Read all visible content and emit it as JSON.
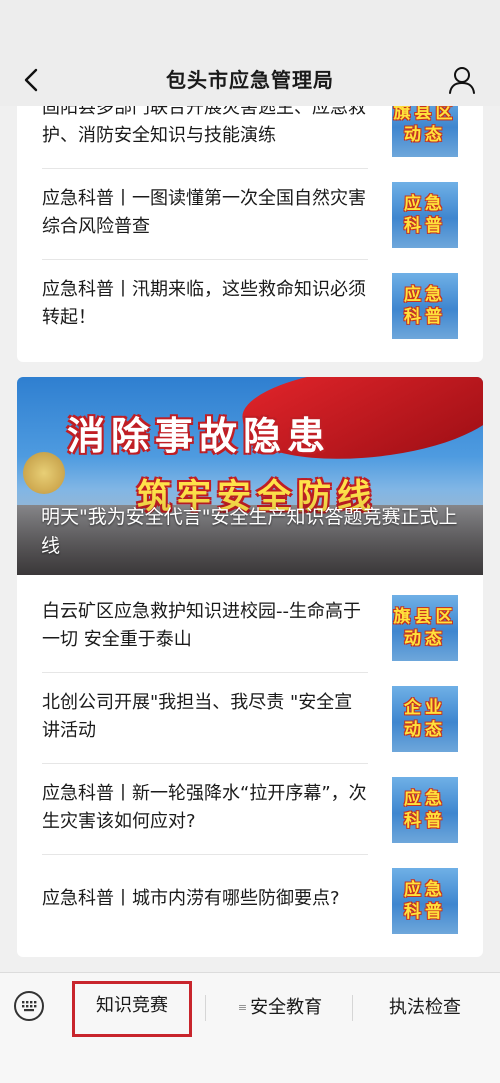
{
  "header": {
    "title": "包头市应急管理局"
  },
  "card1": {
    "items": [
      {
        "title": "固阳县多部门联合开展灾害逃生、应急救护、消防安全知识与技能演练",
        "thumb": [
          "旗县区",
          "动态"
        ]
      },
      {
        "title": "应急科普丨一图读懂第一次全国自然灾害综合风险普查",
        "thumb": [
          "应急",
          "科普"
        ]
      },
      {
        "title": "应急科普丨汛期来临，这些救命知识必须转起！",
        "thumb": [
          "应急",
          "科普"
        ]
      }
    ]
  },
  "banner": {
    "slogan_top": "消除事故隐患",
    "slogan_bottom": "筑牢安全防线",
    "caption": "明天\"我为安全代言\"安全生产知识答题竞赛正式上线"
  },
  "card2": {
    "items": [
      {
        "title": "白云矿区应急救护知识进校园--生命高于一切 安全重于泰山",
        "thumb": [
          "旗县区",
          "动态"
        ]
      },
      {
        "title": "北创公司开展\"我担当、我尽责 \"安全宣讲活动",
        "thumb": [
          "企业",
          "动态"
        ]
      },
      {
        "title": "应急科普丨新一轮强降水“拉开序幕”，次生灾害该如何应对?",
        "thumb": [
          "应急",
          "科普"
        ]
      },
      {
        "title": "应急科普丨城市内涝有哪些防御要点?",
        "thumb": [
          "应急",
          "科普"
        ]
      }
    ]
  },
  "bottom_menu": {
    "items": [
      "知识竞赛",
      "安全教育",
      "执法检查"
    ],
    "selected": "知识竞赛"
  },
  "colors": {
    "highlight_border": "#c8252c",
    "thumb_text": "#ffe23c",
    "thumb_bg": "#3f86cf"
  }
}
